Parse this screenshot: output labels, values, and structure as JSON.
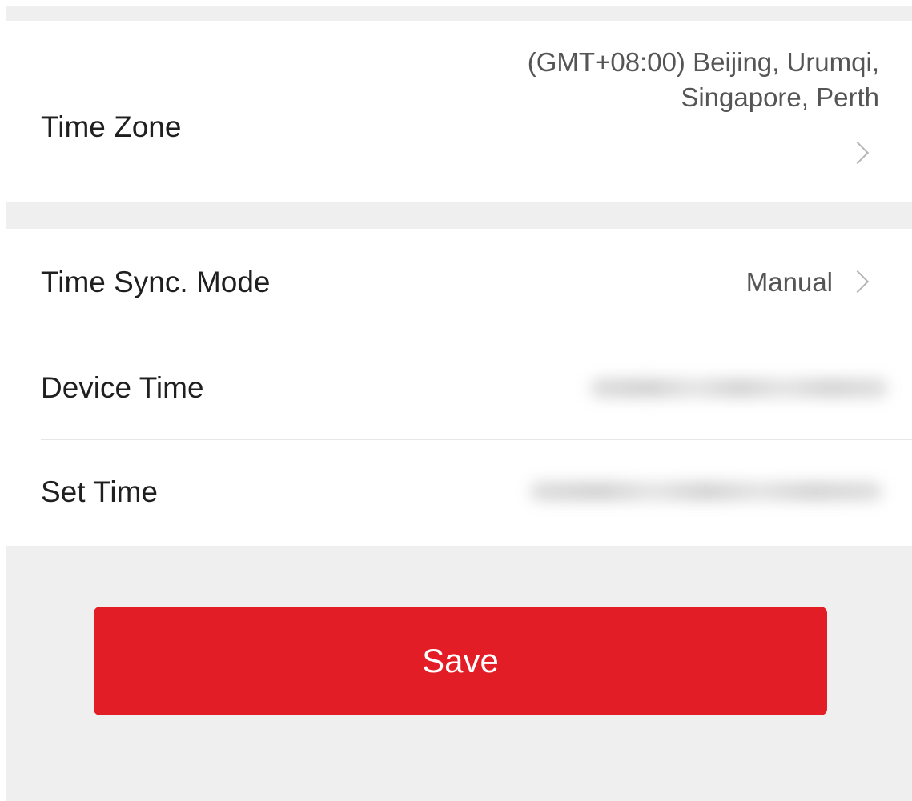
{
  "time_zone": {
    "label": "Time Zone",
    "value_line1": "(GMT+08:00) Beijing, Urumqi,",
    "value_line2": "Singapore, Perth"
  },
  "time_sync_mode": {
    "label": "Time Sync. Mode",
    "value": "Manual"
  },
  "device_time": {
    "label": "Device Time"
  },
  "set_time": {
    "label": "Set Time"
  },
  "save_button": {
    "label": "Save"
  },
  "colors": {
    "accent": "#e31d25",
    "background": "#efefef",
    "card": "#ffffff"
  }
}
